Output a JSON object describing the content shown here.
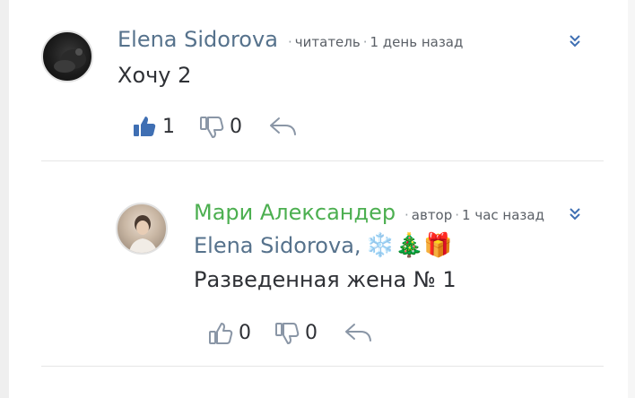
{
  "comments": [
    {
      "author": "Elena Sidorova",
      "role": "читатель",
      "time": "1 день назад",
      "text": "Хочу 2",
      "likes": "1",
      "dislikes": "0"
    },
    {
      "author": "Мари Александер",
      "role": "автор",
      "time": "1 час назад",
      "mention": "Elena Sidorova,",
      "emoji": "❄️🎄🎁",
      "text": "Разведенная жена № 1",
      "likes": "0",
      "dislikes": "0"
    }
  ],
  "colors": {
    "author_blue": "#56728c",
    "author_green": "#4caf50",
    "icon_blue": "#3f6fb3",
    "icon_outline": "#8a96a6",
    "meta": "#5a5f66"
  },
  "meta_separator": "·"
}
